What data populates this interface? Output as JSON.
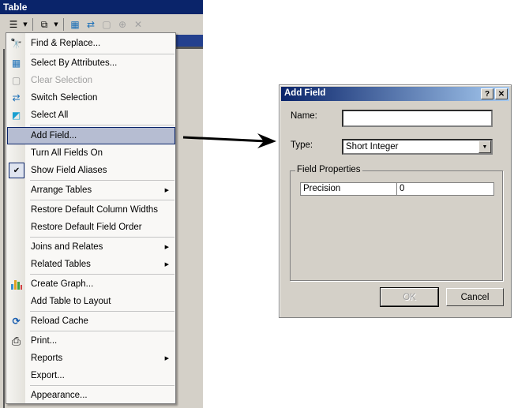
{
  "table_window": {
    "title": "Table",
    "toolbar": [
      {
        "name": "table-options-icon",
        "glyph": "☰"
      },
      {
        "name": "related-tables-icon",
        "glyph": "⧉"
      },
      {
        "name": "select-by-attributes-icon",
        "glyph": "▦"
      },
      {
        "name": "switch-selection-icon",
        "glyph": "⇄"
      },
      {
        "name": "clear-selection-icon",
        "glyph": "▢"
      },
      {
        "name": "zoom-to-selected-icon",
        "glyph": "⊕"
      },
      {
        "name": "delete-selected-icon",
        "glyph": "✕"
      }
    ]
  },
  "menu": {
    "items": [
      {
        "label": "Find & Replace...",
        "icon": "binoculars-icon",
        "glyph": "⛓"
      },
      {
        "label": "Select By Attributes...",
        "icon": "select-by-attributes-icon",
        "glyph": "▦"
      },
      {
        "label": "Clear Selection",
        "icon": "clear-selection-icon",
        "glyph": "▢",
        "disabled": true
      },
      {
        "label": "Switch Selection",
        "icon": "switch-selection-icon",
        "glyph": "⇄"
      },
      {
        "label": "Select All",
        "icon": "select-all-icon",
        "glyph": "◩"
      },
      {
        "label": "Add Field...",
        "highlighted": true
      },
      {
        "label": "Turn All Fields On"
      },
      {
        "label": "Show Field Aliases",
        "checked": true,
        "glyph": "✔"
      },
      {
        "label": "Arrange Tables",
        "submenu": true
      },
      {
        "label": "Restore Default Column Widths"
      },
      {
        "label": "Restore Default Field Order"
      },
      {
        "label": "Joins and Relates",
        "submenu": true
      },
      {
        "label": "Related Tables",
        "submenu": true
      },
      {
        "label": "Create Graph...",
        "icon": "bar-graph-icon",
        "glyph": "📊"
      },
      {
        "label": "Add Table to Layout"
      },
      {
        "label": "Reload Cache",
        "icon": "refresh-icon",
        "glyph": "⟳"
      },
      {
        "label": "Print...",
        "icon": "printer-icon",
        "glyph": "⎙"
      },
      {
        "label": "Reports",
        "submenu": true
      },
      {
        "label": "Export..."
      },
      {
        "label": "Appearance..."
      }
    ],
    "submenu_glyph": "▶"
  },
  "dialog": {
    "title": "Add Field",
    "help_glyph": "?",
    "close_glyph": "✕",
    "name_label": "Name:",
    "name_value": "",
    "type_label": "Type:",
    "type_value": "Short Integer",
    "dropdown_glyph": "▼",
    "group_label": "Field Properties",
    "properties": [
      {
        "name": "Precision",
        "value": "0"
      }
    ],
    "ok_label": "OK",
    "cancel_label": "Cancel"
  }
}
